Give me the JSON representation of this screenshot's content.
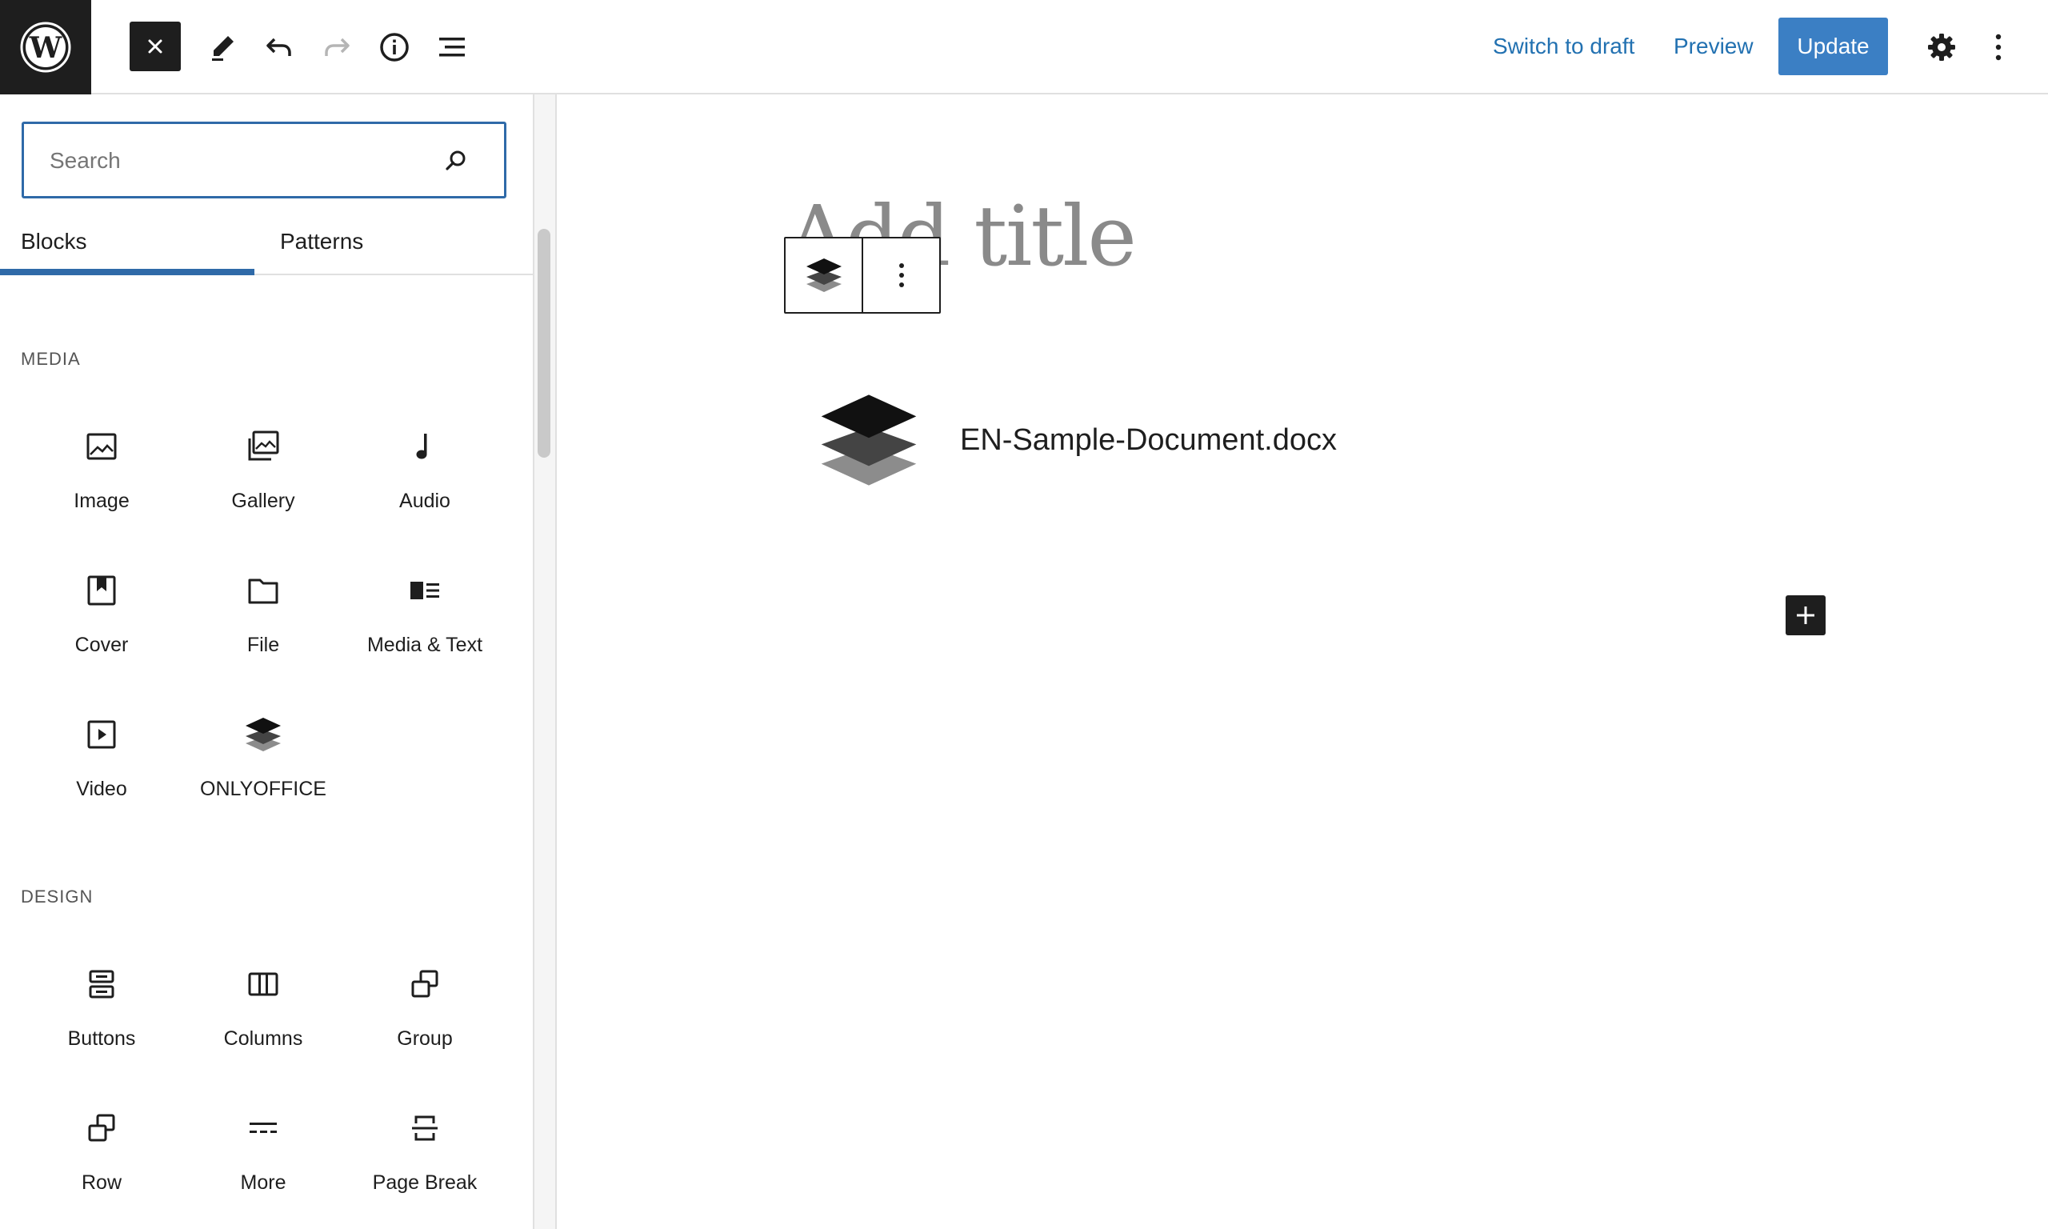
{
  "topbar": {
    "logo_icon": "wordpress-logo-icon",
    "close_icon": "close-icon",
    "tools": [
      "pencil-icon",
      "undo-icon",
      "redo-icon",
      "info-icon",
      "list-view-icon"
    ],
    "switch_to_draft": "Switch to draft",
    "preview": "Preview",
    "update": "Update",
    "settings_icon": "gear-icon",
    "options_icon": "more-vertical-icon"
  },
  "sidebar": {
    "search_placeholder": "Search",
    "tabs": [
      {
        "label": "Blocks",
        "active": true
      },
      {
        "label": "Patterns",
        "active": false
      }
    ],
    "categories": [
      {
        "title": "MEDIA",
        "blocks": [
          {
            "label": "Image",
            "icon": "image-icon"
          },
          {
            "label": "Gallery",
            "icon": "gallery-icon"
          },
          {
            "label": "Audio",
            "icon": "audio-icon"
          },
          {
            "label": "Cover",
            "icon": "cover-icon"
          },
          {
            "label": "File",
            "icon": "file-icon"
          },
          {
            "label": "Media & Text",
            "icon": "media-text-icon"
          },
          {
            "label": "Video",
            "icon": "video-icon"
          },
          {
            "label": "ONLYOFFICE",
            "icon": "onlyoffice-icon"
          }
        ]
      },
      {
        "title": "DESIGN",
        "blocks": [
          {
            "label": "Buttons",
            "icon": "buttons-icon"
          },
          {
            "label": "Columns",
            "icon": "columns-icon"
          },
          {
            "label": "Group",
            "icon": "group-icon"
          },
          {
            "label": "Row",
            "icon": "row-icon"
          },
          {
            "label": "More",
            "icon": "more-icon"
          },
          {
            "label": "Page Break",
            "icon": "page-break-icon"
          }
        ]
      }
    ]
  },
  "canvas": {
    "title_placeholder": "Add title",
    "document_name": "EN-Sample-Document.docx",
    "add_block_icon": "plus-icon"
  },
  "colors": {
    "accent": "#2271b1",
    "update_button": "#3b7fc4",
    "dark": "#1e1e1e"
  }
}
